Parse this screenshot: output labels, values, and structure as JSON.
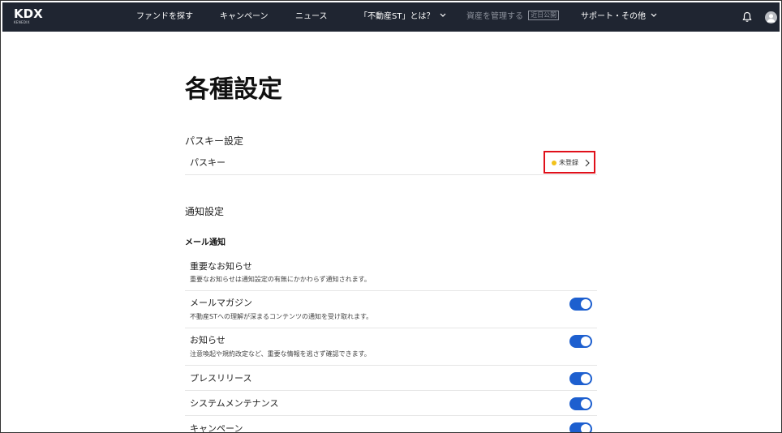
{
  "nav": {
    "logo": "KDX",
    "logo_sub": "KENEDIX",
    "items": [
      {
        "label": "ファンドを探す"
      },
      {
        "label": "キャンペーン"
      },
      {
        "label": "ニュース"
      },
      {
        "label": "「不動産ST」とは？"
      },
      {
        "label": "資産を管理する"
      },
      {
        "label": "サポート・その他"
      }
    ],
    "soon_badge": "近日公開"
  },
  "page": {
    "title": "各種設定"
  },
  "passkey": {
    "section_title": "パスキー設定",
    "row_label": "パスキー",
    "status": "未登録",
    "status_color": "#f2c21b",
    "highlight_color": "#e0101a"
  },
  "notifications": {
    "section_title": "通知設定",
    "email_title": "メール通知",
    "items": [
      {
        "label": "重要なお知らせ",
        "desc": "重要なお知らせは通知設定の有無にかかわらず通知されます。"
      },
      {
        "label": "メールマガジン",
        "desc": "不動産STへの理解が深まるコンテンツの通知を受け取れます。",
        "on": true
      },
      {
        "label": "お知らせ",
        "desc": "注意喚起や規約改定など、重要な情報を逃さず確認できます。",
        "on": true
      },
      {
        "label": "プレスリリース",
        "on": true
      },
      {
        "label": "システムメンテナンス",
        "on": true
      },
      {
        "label": "キャンペーン",
        "on": true
      }
    ],
    "toggle_color": "#1d5fcf"
  }
}
